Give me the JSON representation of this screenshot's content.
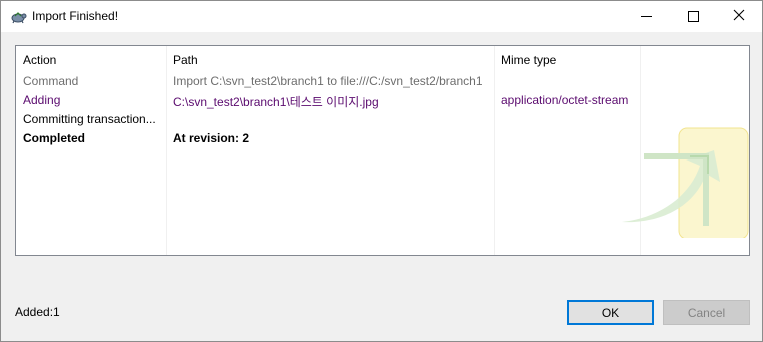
{
  "window": {
    "title": "Import Finished!",
    "icon": "tortoise-svn-icon"
  },
  "titlebar_buttons": {
    "minimize": "minimize-icon",
    "maximize": "maximize-icon",
    "close": "close-icon"
  },
  "list": {
    "columns": [
      "Action",
      "Path",
      "Mime type"
    ],
    "rows": [
      {
        "action": "Command",
        "path": "Import C:\\svn_test2\\branch1 to file:///C:/svn_test2/branch1",
        "mime": "",
        "style": "gray"
      },
      {
        "action": "Adding",
        "path": "C:\\svn_test2\\branch1\\테스트 이미지.jpg",
        "mime": "application/octet-stream",
        "style": "purple"
      },
      {
        "action": "Committing transaction...",
        "path": "",
        "mime": "",
        "style": "black"
      },
      {
        "action": "Completed",
        "path": "At revision: 2",
        "mime": "",
        "style": "bold"
      }
    ]
  },
  "status": {
    "summary": "Added:1"
  },
  "buttons": {
    "ok": "OK",
    "cancel": "Cancel"
  },
  "colors": {
    "command_text": "#6d6d6d",
    "adding_text": "#5a0a6e",
    "default_button_border": "#0078d7"
  }
}
